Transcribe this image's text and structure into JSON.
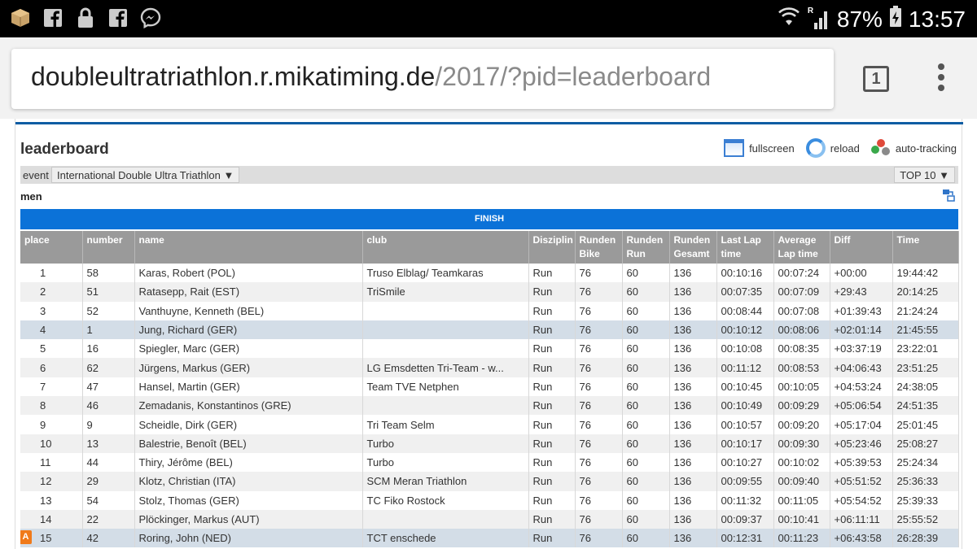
{
  "status_bar": {
    "icons_left": [
      "cube-app-icon",
      "facebook-icon",
      "lock-icon",
      "facebook-icon",
      "messenger-icon"
    ],
    "signal_label": "R",
    "battery": "87%",
    "time": "13:57"
  },
  "browser": {
    "url_domain": "doubleultratriathlon.r.mikatiming.de",
    "url_path": "/2017/?pid=leaderboard",
    "tab_count": "1"
  },
  "page": {
    "heading": "leaderboard",
    "tools": {
      "fullscreen": "fullscreen",
      "reload": "reload",
      "auto_tracking": "auto-tracking"
    },
    "event_label": "event",
    "event_value": "International Double Ultra Triathlon ▼",
    "top_value": "TOP 10 ▼",
    "section": "men",
    "banner": "FINISH"
  },
  "table": {
    "headers": [
      "place",
      "number",
      "name",
      "club",
      "Disziplin",
      "Runden Bike",
      "Runden Run",
      "Runden Gesamt",
      "Last Lap time",
      "Average Lap time",
      "Diff",
      "Time"
    ],
    "rows": [
      [
        "1",
        "58",
        "Karas, Robert (POL)",
        "Truso Elblag/ Teamkaras",
        "Run",
        "76",
        "60",
        "136",
        "00:10:16",
        "00:07:24",
        "+00:00",
        "19:44:42"
      ],
      [
        "2",
        "51",
        "Ratasepp, Rait (EST)",
        "TriSmile",
        "Run",
        "76",
        "60",
        "136",
        "00:07:35",
        "00:07:09",
        "+29:43",
        "20:14:25"
      ],
      [
        "3",
        "52",
        "Vanthuyne, Kenneth (BEL)",
        "",
        "Run",
        "76",
        "60",
        "136",
        "00:08:44",
        "00:07:08",
        "+01:39:43",
        "21:24:24"
      ],
      [
        "4",
        "1",
        "Jung, Richard (GER)",
        "",
        "Run",
        "76",
        "60",
        "136",
        "00:10:12",
        "00:08:06",
        "+02:01:14",
        "21:45:55"
      ],
      [
        "5",
        "16",
        "Spiegler, Marc (GER)",
        "",
        "Run",
        "76",
        "60",
        "136",
        "00:10:08",
        "00:08:35",
        "+03:37:19",
        "23:22:01"
      ],
      [
        "6",
        "62",
        "Jürgens, Markus (GER)",
        "LG Emsdetten Tri-Team - w...",
        "Run",
        "76",
        "60",
        "136",
        "00:11:12",
        "00:08:53",
        "+04:06:43",
        "23:51:25"
      ],
      [
        "7",
        "47",
        "Hansel, Martin (GER)",
        "Team TVE Netphen",
        "Run",
        "76",
        "60",
        "136",
        "00:10:45",
        "00:10:05",
        "+04:53:24",
        "24:38:05"
      ],
      [
        "8",
        "46",
        "Zemadanis, Konstantinos (GRE)",
        "",
        "Run",
        "76",
        "60",
        "136",
        "00:10:49",
        "00:09:29",
        "+05:06:54",
        "24:51:35"
      ],
      [
        "9",
        "9",
        "Scheidle, Dirk (GER)",
        "Tri Team Selm",
        "Run",
        "76",
        "60",
        "136",
        "00:10:57",
        "00:09:20",
        "+05:17:04",
        "25:01:45"
      ],
      [
        "10",
        "13",
        "Balestrie, Benoît (BEL)",
        "Turbo",
        "Run",
        "76",
        "60",
        "136",
        "00:10:17",
        "00:09:30",
        "+05:23:46",
        "25:08:27"
      ],
      [
        "11",
        "44",
        "Thiry, Jérôme (BEL)",
        "Turbo",
        "Run",
        "76",
        "60",
        "136",
        "00:10:27",
        "00:10:02",
        "+05:39:53",
        "25:24:34"
      ],
      [
        "12",
        "29",
        "Klotz, Christian (ITA)",
        "SCM Meran Triathlon",
        "Run",
        "76",
        "60",
        "136",
        "00:09:55",
        "00:09:40",
        "+05:51:52",
        "25:36:33"
      ],
      [
        "13",
        "54",
        "Stolz, Thomas (GER)",
        "TC Fiko Rostock",
        "Run",
        "76",
        "60",
        "136",
        "00:11:32",
        "00:11:05",
        "+05:54:52",
        "25:39:33"
      ],
      [
        "14",
        "22",
        "Plöckinger, Markus (AUT)",
        "",
        "Run",
        "76",
        "60",
        "136",
        "00:09:37",
        "00:10:41",
        "+06:11:11",
        "25:55:52"
      ],
      [
        "15",
        "42",
        "Roring, John (NED)",
        "TCT enschede",
        "Run",
        "76",
        "60",
        "136",
        "00:12:31",
        "00:11:23",
        "+06:43:58",
        "26:28:39"
      ]
    ],
    "highlighted_rows": [
      3,
      14
    ],
    "row_markers": {
      "14": "A"
    }
  },
  "colors": {
    "banner": "#0b72d8",
    "header": "#9a9a9a",
    "highlight": "#d3dde7",
    "marker": "#f07a1a"
  }
}
